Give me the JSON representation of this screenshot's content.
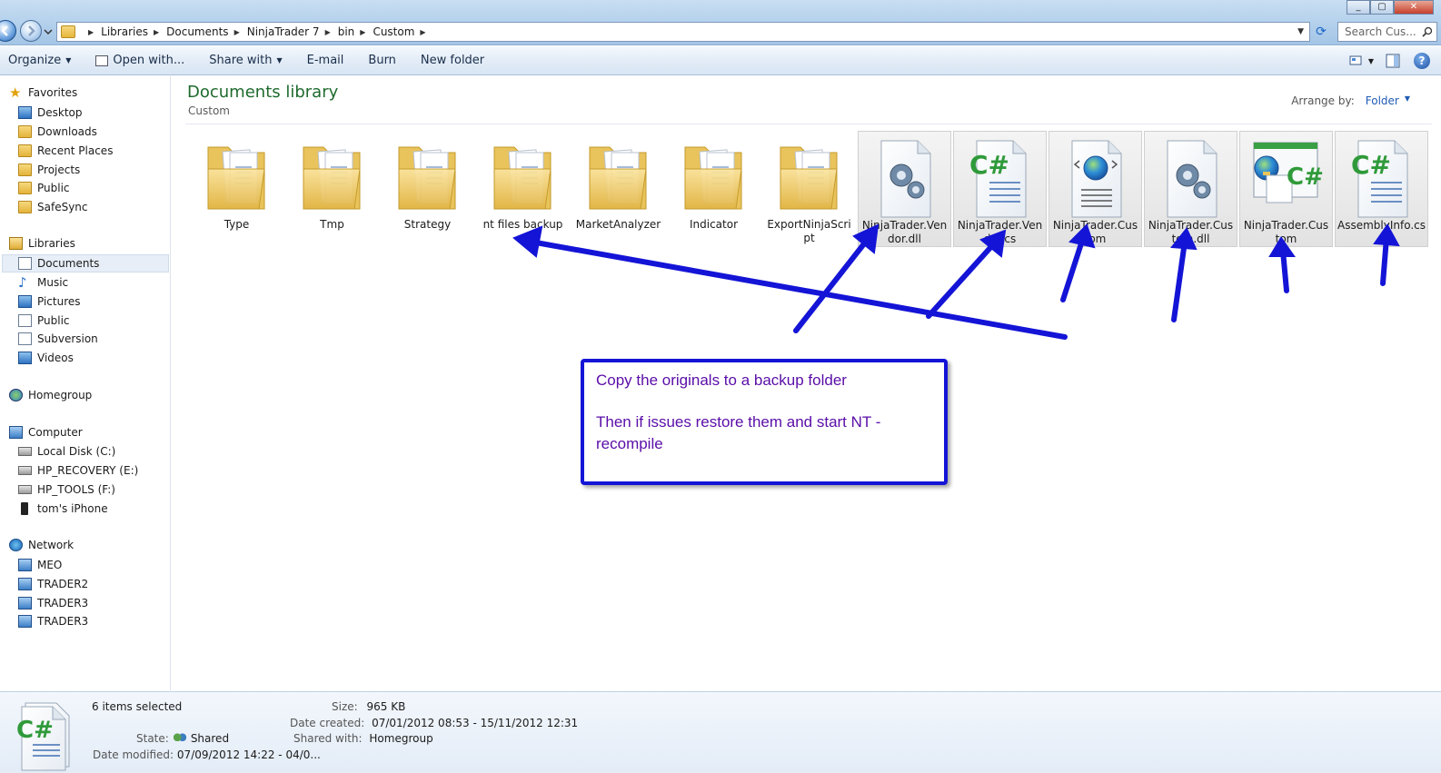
{
  "address": {
    "crumbs": [
      "Libraries",
      "Documents",
      "NinjaTrader 7",
      "bin",
      "Custom"
    ],
    "search_placeholder": "Search Cus..."
  },
  "toolbar": {
    "organize": "Organize",
    "open_with": "Open with...",
    "share_with": "Share with",
    "email": "E-mail",
    "burn": "Burn",
    "new_folder": "New folder"
  },
  "nav": {
    "favorites": "Favorites",
    "favorites_items": [
      "Desktop",
      "Downloads",
      "Recent Places",
      "Projects",
      "Public",
      "SafeSync"
    ],
    "libraries": "Libraries",
    "libraries_items": [
      "Documents",
      "Music",
      "Pictures",
      "Public",
      "Subversion",
      "Videos"
    ],
    "homegroup": "Homegroup",
    "computer": "Computer",
    "computer_items": [
      "Local Disk (C:)",
      "HP_RECOVERY (E:)",
      "HP_TOOLS (F:)",
      "tom's iPhone"
    ],
    "network": "Network",
    "network_items": [
      "MEO",
      "TRADER2",
      "TRADER3",
      "TRADER3"
    ]
  },
  "content": {
    "title": "Documents library",
    "subtitle": "Custom",
    "arrange_label": "Arrange by:",
    "arrange_value": "Folder",
    "items": [
      {
        "label": "Type",
        "kind": "folder",
        "selected": false
      },
      {
        "label": "Tmp",
        "kind": "folder",
        "selected": false
      },
      {
        "label": "Strategy",
        "kind": "folder",
        "selected": false
      },
      {
        "label": "nt files backup",
        "kind": "folder",
        "selected": false
      },
      {
        "label": "MarketAnalyzer",
        "kind": "folder",
        "selected": false
      },
      {
        "label": "Indicator",
        "kind": "folder",
        "selected": false
      },
      {
        "label": "ExportNinjaScript",
        "kind": "folder",
        "selected": false
      },
      {
        "label": "NinjaTrader.Vendor.dll",
        "kind": "dll",
        "selected": true
      },
      {
        "label": "NinjaTrader.Vendor.cs",
        "kind": "cs",
        "selected": true
      },
      {
        "label": "NinjaTrader.Custom",
        "kind": "xml",
        "selected": true
      },
      {
        "label": "NinjaTrader.Custom.dll",
        "kind": "dll",
        "selected": true
      },
      {
        "label": "NinjaTrader.Custom",
        "kind": "csproj",
        "selected": true
      },
      {
        "label": "AssemblyInfo.cs",
        "kind": "cs",
        "selected": true
      }
    ]
  },
  "annotation": {
    "line1": "Copy the originals to a backup folder",
    "line2": "Then if issues restore them and start NT - recompile"
  },
  "details": {
    "count": "6 items selected",
    "state_label": "State:",
    "state_value": "Shared",
    "modified_label": "Date modified:",
    "modified_value": "07/09/2012 14:22 - 04/0...",
    "size_label": "Size:",
    "size_value": "965 KB",
    "created_label": "Date created:",
    "created_value": "07/01/2012 08:53 - 15/11/2012 12:31",
    "shared_label": "Shared with:",
    "shared_value": "Homegroup"
  },
  "colors": {
    "title_green": "#1e6a2d",
    "annotation_blue": "#1414d7",
    "annotation_text": "#5a0da8"
  }
}
